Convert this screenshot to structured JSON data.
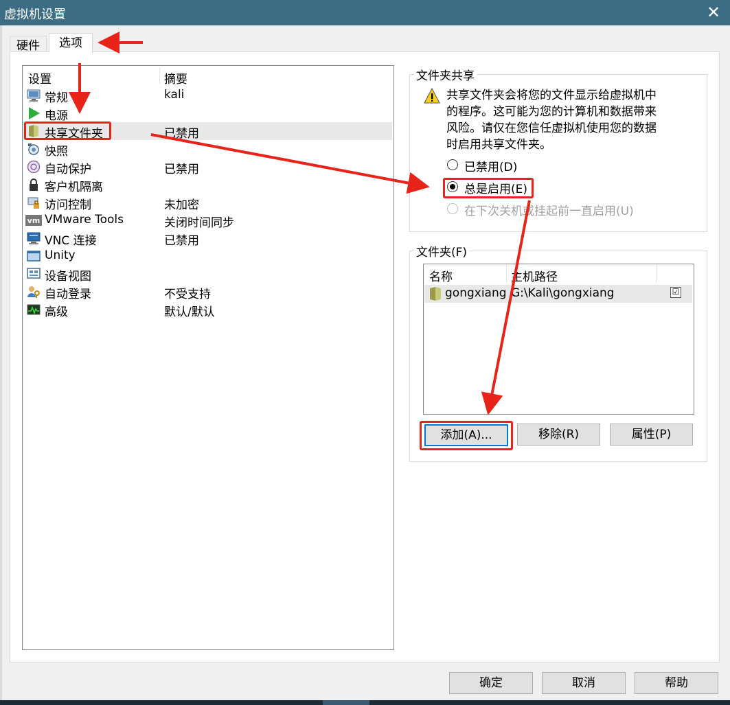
{
  "window": {
    "title": "虚拟机设置",
    "close_glyph": "✕"
  },
  "tabs": {
    "hardware": "硬件",
    "options": "选项"
  },
  "list": {
    "header": {
      "setting": "设置",
      "summary": "摘要"
    },
    "items": [
      {
        "name": "常规",
        "summary": "kali",
        "icon": "monitor-icon"
      },
      {
        "name": "电源",
        "summary": "",
        "icon": "play-icon"
      },
      {
        "name": "共享文件夹",
        "summary": "已禁用",
        "icon": "shared-folder-icon"
      },
      {
        "name": "快照",
        "summary": "",
        "icon": "snapshot-icon"
      },
      {
        "name": "自动保护",
        "summary": "已禁用",
        "icon": "autoprotect-icon"
      },
      {
        "name": "客户机隔离",
        "summary": "",
        "icon": "lock-icon"
      },
      {
        "name": "访问控制",
        "summary": "未加密",
        "icon": "access-control-icon"
      },
      {
        "name": "VMware Tools",
        "summary": "关闭时间同步",
        "icon": "vmware-tools-icon"
      },
      {
        "name": "VNC 连接",
        "summary": "已禁用",
        "icon": "vnc-icon"
      },
      {
        "name": "Unity",
        "summary": "",
        "icon": "unity-icon"
      },
      {
        "name": "设备视图",
        "summary": "",
        "icon": "device-view-icon"
      },
      {
        "name": "自动登录",
        "summary": "不受支持",
        "icon": "autologin-icon"
      },
      {
        "name": "高级",
        "summary": "默认/默认",
        "icon": "advanced-icon"
      }
    ]
  },
  "sharing": {
    "legend": "文件夹共享",
    "warning": "共享文件夹会将您的文件显示给虚拟机中的程序。这可能为您的计算机和数据带来风险。请仅在您信任虚拟机使用您的数据时启用共享文件夹。",
    "options": {
      "disabled": "已禁用(D)",
      "always": "总是启用(E)",
      "until_off": "在下次关机或挂起前一直启用(U)"
    },
    "selected": "总是启用(E)"
  },
  "folders": {
    "legend": "文件夹(F)",
    "columns": {
      "name": "名称",
      "path": "主机路径"
    },
    "rows": [
      {
        "name": "gongxiang",
        "path": "G:\\Kali\\gongxiang",
        "check": "☑"
      }
    ],
    "buttons": {
      "add": "添加(A)...",
      "remove": "移除(R)",
      "properties": "属性(P)"
    }
  },
  "footer": {
    "ok": "确定",
    "cancel": "取消",
    "help": "帮助"
  },
  "colors": {
    "titlebar": "#3d6d84",
    "annotation": "#e8231a",
    "selection": "#e8e8e8"
  }
}
